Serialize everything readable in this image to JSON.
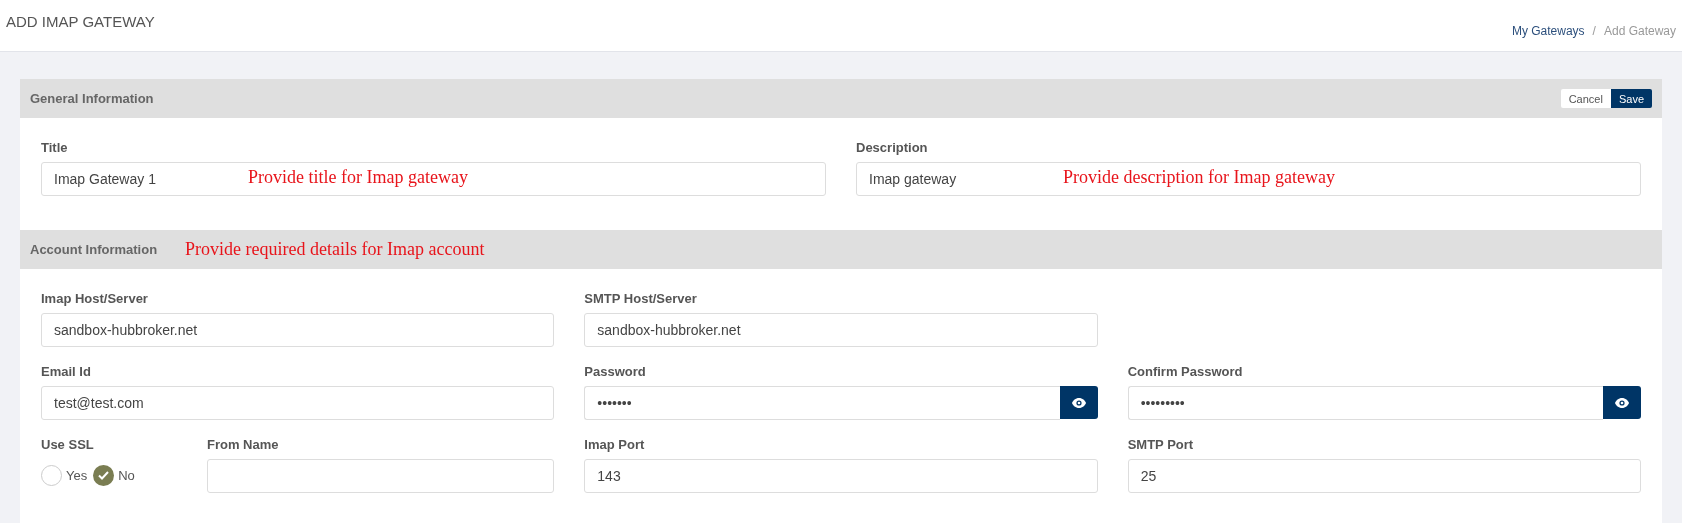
{
  "page": {
    "title": "ADD IMAP GATEWAY",
    "breadcrumb": [
      {
        "label": "My Gateways",
        "kind": "link"
      },
      {
        "label": "/",
        "kind": "separator"
      },
      {
        "label": "Add Gateway",
        "kind": "current"
      }
    ]
  },
  "general": {
    "title": "General Information",
    "buttons": [
      {
        "label": "Cancel",
        "kind": "secondary"
      },
      {
        "label": "Save",
        "kind": "primary"
      }
    ],
    "fields": [
      {
        "label": "Title",
        "kind": "text",
        "value": "Imap Gateway 1",
        "note": "Provide title for Imap gateway"
      },
      {
        "label": "Description",
        "kind": "text",
        "value": "Imap gateway",
        "note": "Provide description for Imap gateway"
      }
    ]
  },
  "account": {
    "title": "Account Information",
    "note": "Provide required details for Imap account",
    "rows": [
      [
        {
          "label": "Imap Host/Server",
          "kind": "text",
          "value": "sandbox-hubbroker.net"
        },
        {
          "label": "SMTP Host/Server",
          "kind": "text",
          "value": "sandbox-hubbroker.net"
        }
      ],
      [
        {
          "label": "Email Id",
          "kind": "text",
          "value": "test@test.com"
        },
        {
          "label": "Password",
          "kind": "password",
          "value": "•••••••"
        },
        {
          "label": "Confirm Password",
          "kind": "password",
          "value": "•••••••••"
        }
      ],
      [
        {
          "kind": "group",
          "fields": [
            {
              "label": "Use SSL",
              "kind": "radio",
              "options": [
                {
                  "label": "Yes",
                  "selected": false
                },
                {
                  "label": "No",
                  "selected": true
                }
              ]
            },
            {
              "label": "From Name",
              "kind": "text"
            }
          ]
        },
        {
          "label": "Imap Port",
          "kind": "text",
          "value": "143"
        },
        {
          "label": "SMTP Port",
          "kind": "text",
          "value": "25"
        }
      ]
    ]
  }
}
